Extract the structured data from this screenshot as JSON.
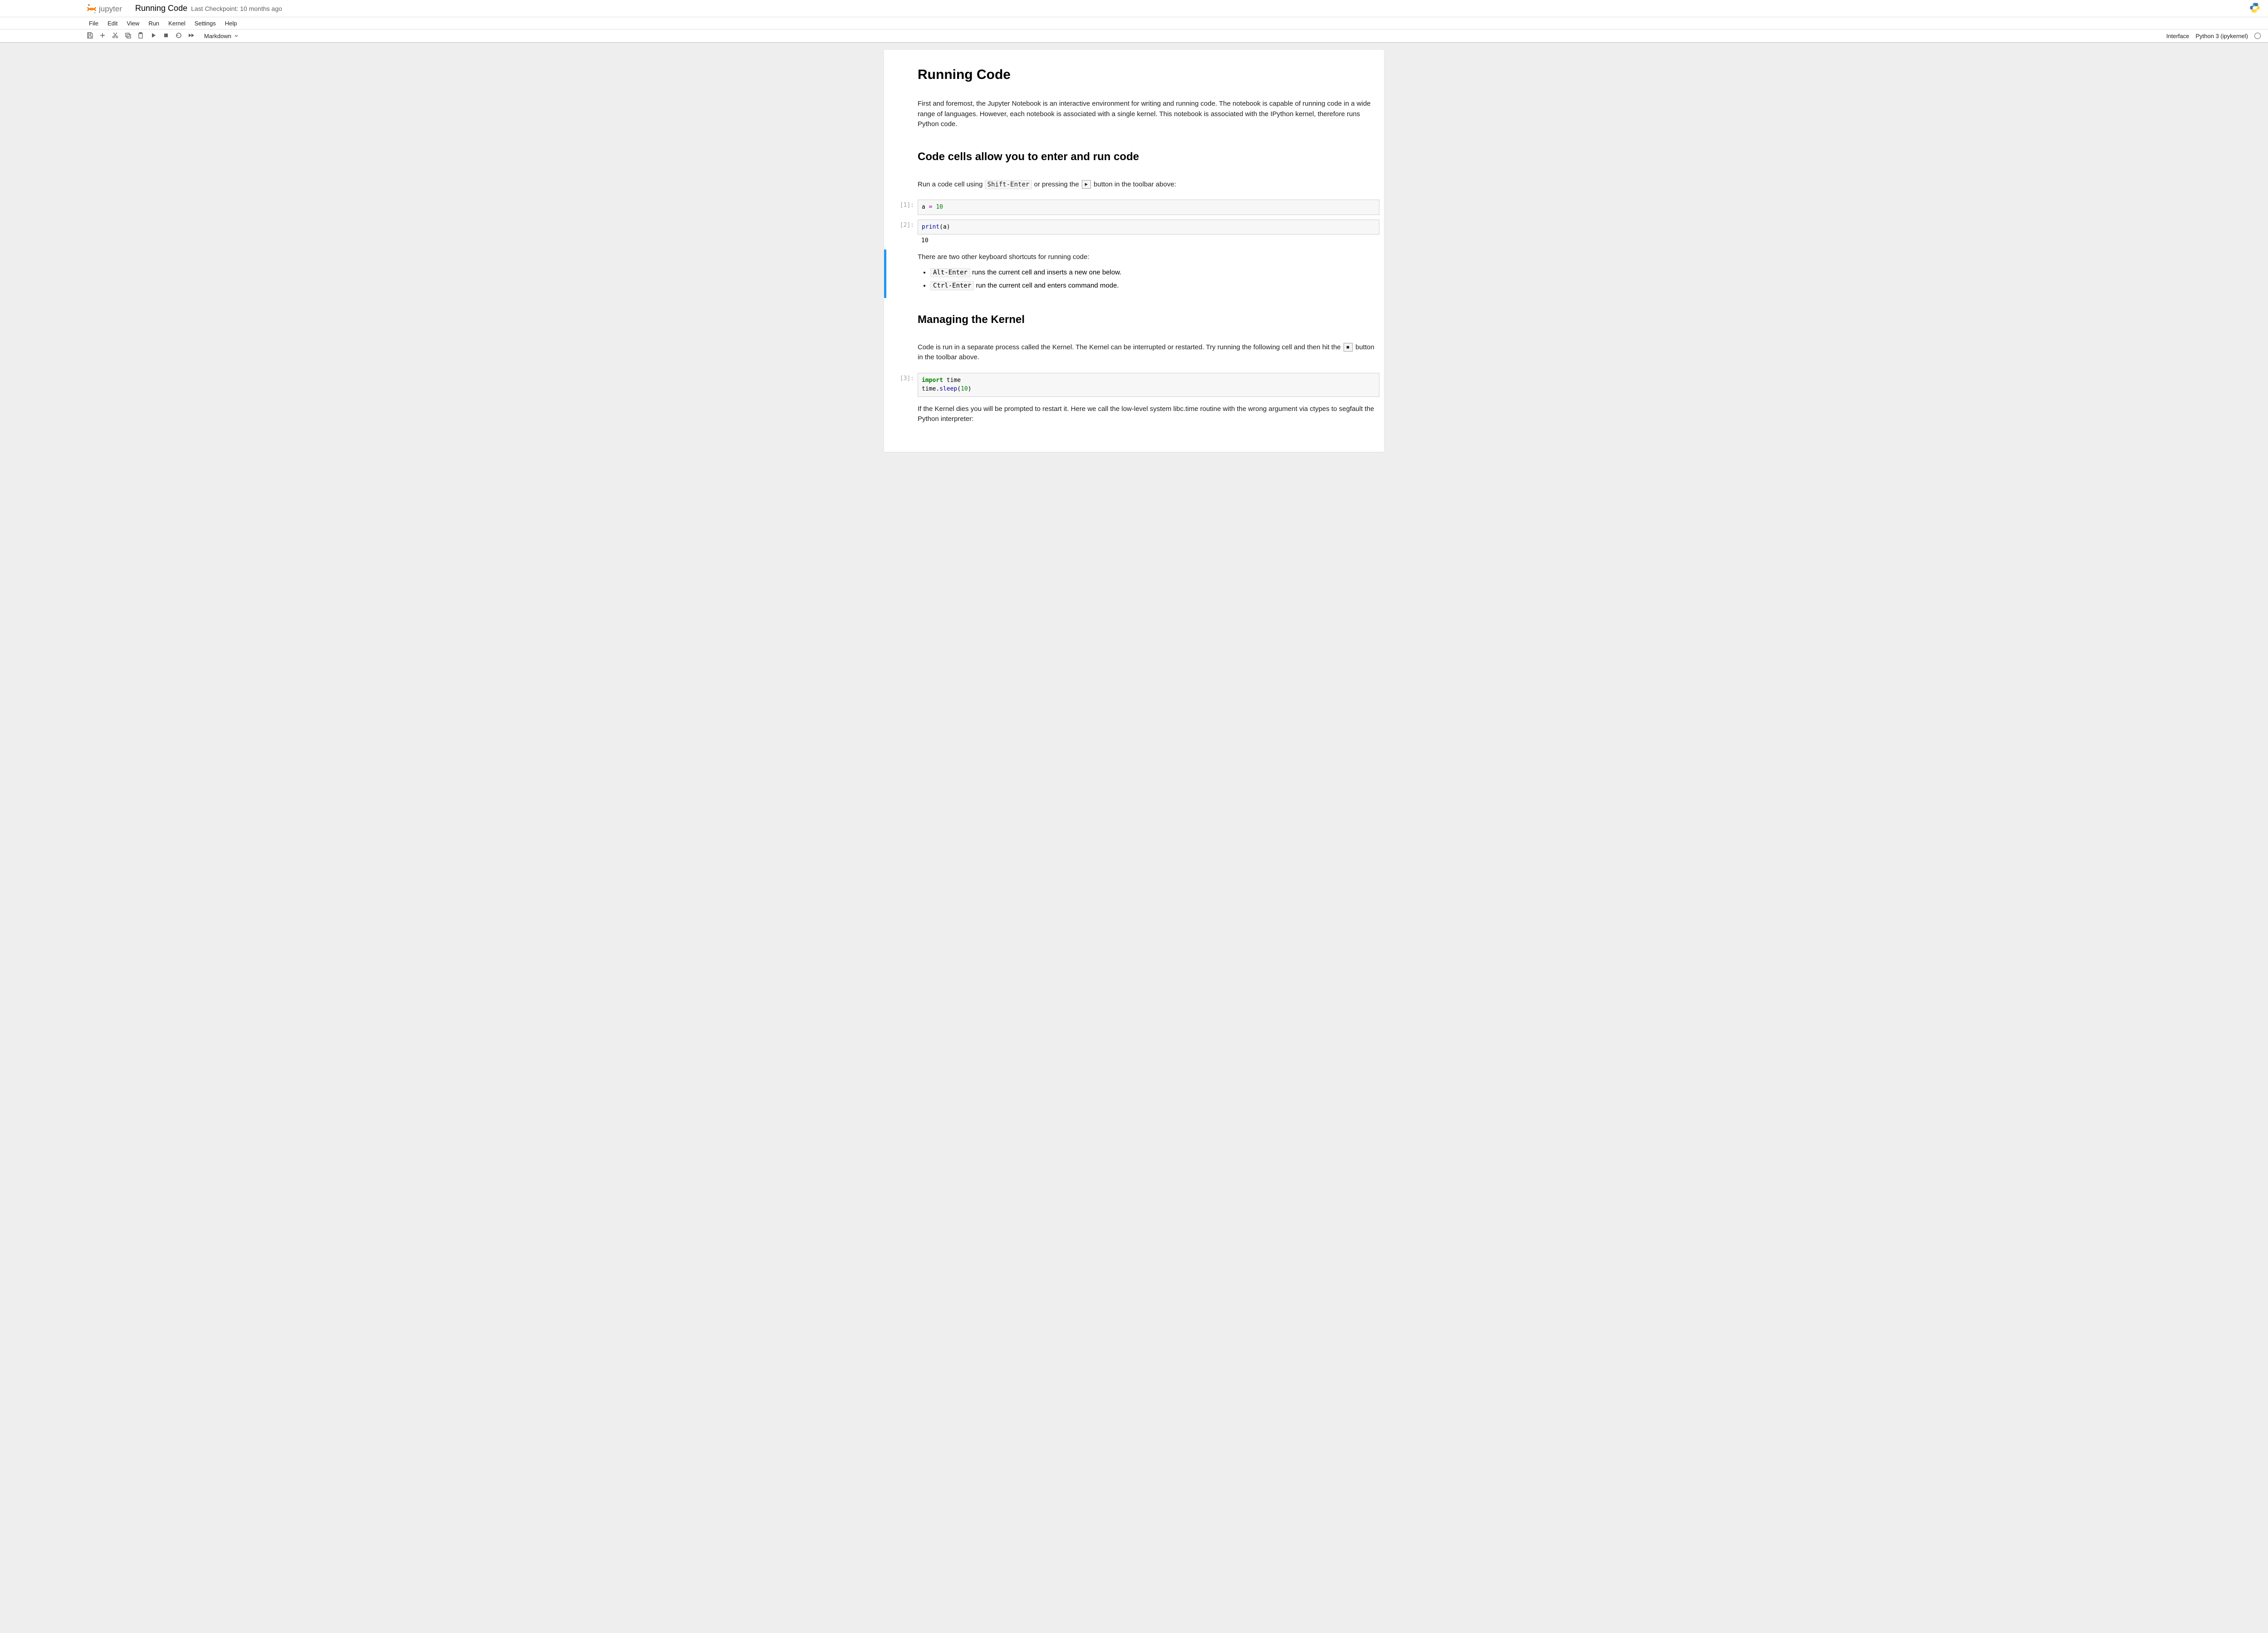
{
  "header": {
    "notebook_title": "Running Code",
    "checkpoint": "Last Checkpoint: 10 months ago"
  },
  "menu": {
    "file": "File",
    "edit": "Edit",
    "view": "View",
    "run": "Run",
    "kernel": "Kernel",
    "settings": "Settings",
    "help": "Help"
  },
  "toolbar": {
    "cell_type": "Markdown",
    "interface": "Interface",
    "kernel_name": "Python 3 (ipykernel)"
  },
  "cells": {
    "md1_h1": "Running Code",
    "md2_p": "First and foremost, the Jupyter Notebook is an interactive environment for writing and running code. The notebook is capable of running code in a wide range of languages. However, each notebook is associated with a single kernel. This notebook is associated with the IPython kernel, therefore runs Python code.",
    "md3_h2": "Code cells allow you to enter and run code",
    "md4_pre": "Run a code cell using ",
    "md4_kbd": "Shift-Enter",
    "md4_mid": " or pressing the ",
    "md4_post": " button in the toolbar above:",
    "code1_prompt": "[1]:",
    "code1_src_a": "a ",
    "code1_src_eq": "=",
    "code1_src_sp": " ",
    "code1_src_num": "10",
    "code2_prompt": "[2]:",
    "code2_src_fn": "print",
    "code2_src_rest": "(a)",
    "code2_out": "10",
    "md5_p": "There are two other keyboard shortcuts for running code:",
    "md5_li1_kbd": "Alt-Enter",
    "md5_li1_txt": " runs the current cell and inserts a new one below.",
    "md5_li2_kbd": "Ctrl-Enter",
    "md5_li2_txt": " run the current cell and enters command mode.",
    "md6_h2": "Managing the Kernel",
    "md7_pre": "Code is run in a separate process called the Kernel. The Kernel can be interrupted or restarted. Try running the following cell and then hit the ",
    "md7_post": " button in the toolbar above.",
    "code3_prompt": "[3]:",
    "code3_l1_kw": "import",
    "code3_l1_rest": " time",
    "code3_l2_pre": "time.",
    "code3_l2_fn": "sleep",
    "code3_l2_open": "(",
    "code3_l2_num": "10",
    "code3_l2_close": ")",
    "md8_p": "If the Kernel dies you will be prompted to restart it. Here we call the low-level system libc.time routine with the wrong argument via ctypes to segfault the Python interpreter:"
  }
}
